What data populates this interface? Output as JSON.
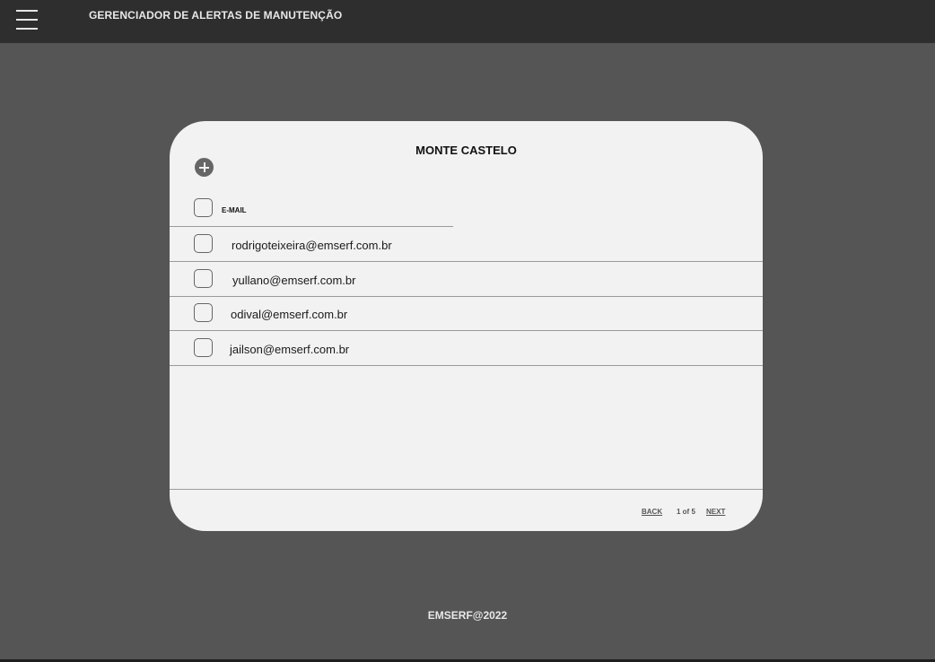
{
  "header": {
    "menu_icon": "hamburger-menu-icon",
    "title": "GERENCIADOR DE ALERTAS DE MANUTENÇÃO"
  },
  "card": {
    "title": "MONTE CASTELO",
    "add_icon": "plus-circle-icon",
    "column_header": "E-MAIL",
    "rows": [
      {
        "email": "rodrigoteixeira@emserf.com.br",
        "checked": false
      },
      {
        "email": "yullano@emserf.com.br",
        "checked": false
      },
      {
        "email": "odival@emserf.com.br",
        "checked": false
      },
      {
        "email": "jailson@emserf.com.br",
        "checked": false
      }
    ],
    "pagination": {
      "back_label": "BACK",
      "page_info": "1 of 5",
      "next_label": "NEXT"
    }
  },
  "footer": {
    "copyright": "EMSERF@2022"
  },
  "colors": {
    "background": "#555555",
    "topbar": "#2e2e2e",
    "card": "#f2f2f2"
  }
}
